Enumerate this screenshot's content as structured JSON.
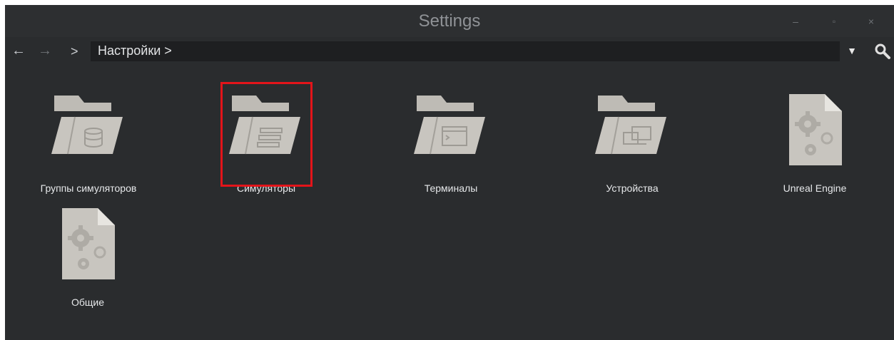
{
  "window": {
    "title": "Settings"
  },
  "controls": {
    "minimize": "–",
    "maximize": "▫",
    "close": "×"
  },
  "nav": {
    "back": "←",
    "forward": "→",
    "separator": ">",
    "path": "Настройки >",
    "dropdown": "▼"
  },
  "items": [
    {
      "label": "Группы симуляторов",
      "icon": "folder-database-icon",
      "type": "folder"
    },
    {
      "label": "Симуляторы",
      "icon": "folder-stack-icon",
      "type": "folder",
      "highlighted": true
    },
    {
      "label": "Терминалы",
      "icon": "folder-terminal-icon",
      "type": "folder"
    },
    {
      "label": "Устройства",
      "icon": "folder-devices-icon",
      "type": "folder"
    },
    {
      "label": "Unreal Engine",
      "icon": "settings-file-icon",
      "type": "file"
    },
    {
      "label": "Общие",
      "icon": "settings-file-icon",
      "type": "file"
    }
  ],
  "colors": {
    "background": "#2a2c2e",
    "icon": "#c8c5bf",
    "highlight": "#e3141a",
    "text": "#e6e8ea"
  }
}
